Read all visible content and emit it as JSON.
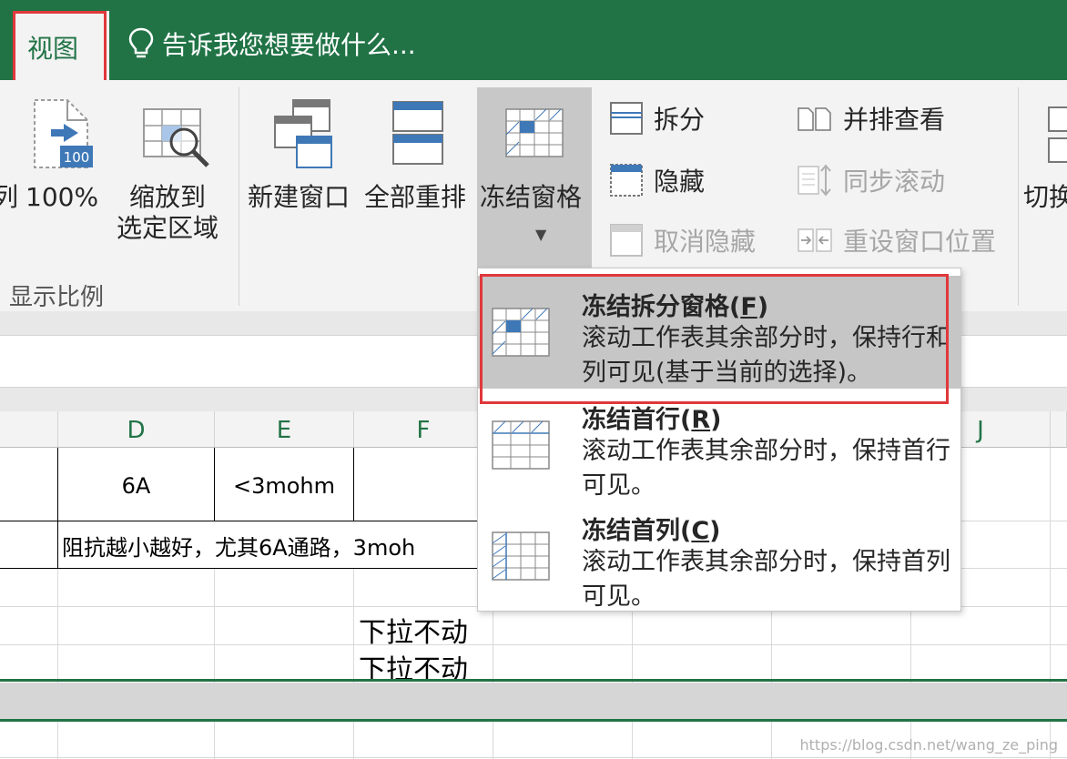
{
  "tabs": {
    "view": "视图",
    "tell_me": "告诉我您想要做什么..."
  },
  "ribbon": {
    "cut_left": "列",
    "zoom_100": "100%",
    "zoom_selection_line1": "缩放到",
    "zoom_selection_line2": "选定区域",
    "zoom_group_label": "显示比例",
    "new_window": "新建窗口",
    "arrange_all": "全部重排",
    "freeze_panes": "冻结窗格",
    "split": "拆分",
    "hide": "隐藏",
    "unhide": "取消隐藏",
    "view_side_by_side": "并排查看",
    "sync_scroll": "同步滚动",
    "reset_position": "重设窗口位置",
    "switch": "切换",
    "zoom_badge": "100"
  },
  "menu": {
    "items": [
      {
        "title_pre": "冻结拆分窗格(",
        "key": "F",
        "title_post": ")",
        "desc": "滚动工作表其余部分时，保持行和列可见(基于当前的选择)。"
      },
      {
        "title_pre": "冻结首行(",
        "key": "R",
        "title_post": ")",
        "desc": "滚动工作表其余部分时，保持首行可见。"
      },
      {
        "title_pre": "冻结首列(",
        "key": "C",
        "title_post": ")",
        "desc": "滚动工作表其余部分时，保持首列可见。"
      }
    ]
  },
  "sheet": {
    "columns": [
      "D",
      "E",
      "F",
      "J"
    ],
    "cells": {
      "d_row1": "6A",
      "e_row1": "<3mohm",
      "row2_text": "阻抗越小越好，尤其6A通路，3moh",
      "f_row4": "下拉不动",
      "f_row5": "下拉不动"
    }
  },
  "watermark": "https://blog.csdn.net/wang_ze_ping",
  "colors": {
    "excel_green": "#217346",
    "highlight_red": "#e0383b",
    "icon_blue": "#3f78b7"
  }
}
